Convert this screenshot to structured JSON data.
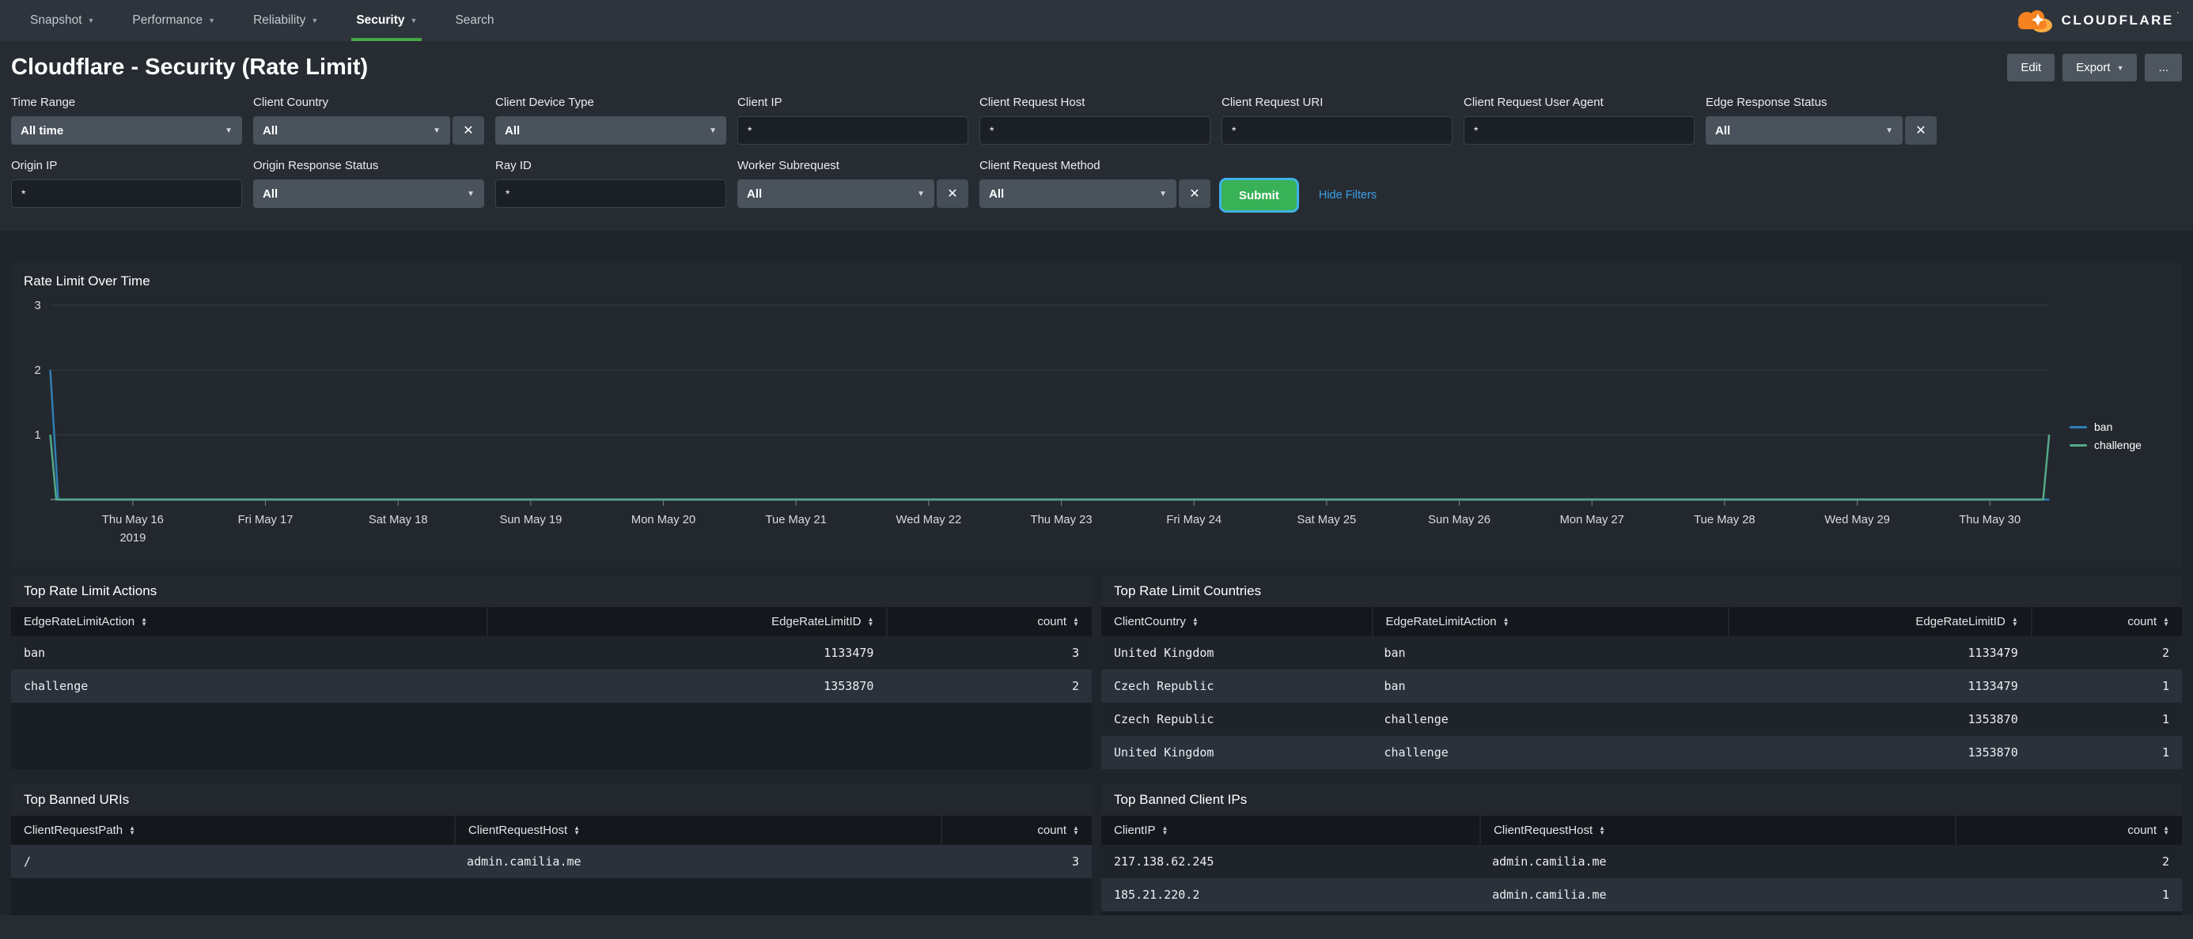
{
  "colors": {
    "accent_green": "#45a745",
    "brand_orange": "#f6821f",
    "brand_orange_light": "#fbad41",
    "submit_green": "#38b157",
    "link_blue": "#3aa0e8",
    "series_ban": "#2f7eb5",
    "series_challenge": "#55a989"
  },
  "icons": {
    "caret": "▼",
    "clear": "✕",
    "sort_asc": "▲",
    "sort_desc": "▼"
  },
  "nav": {
    "items": [
      {
        "label": "Snapshot",
        "caret": true
      },
      {
        "label": "Performance",
        "caret": true
      },
      {
        "label": "Reliability",
        "caret": true
      },
      {
        "label": "Security",
        "caret": true,
        "active": true
      },
      {
        "label": "Search",
        "caret": false
      }
    ]
  },
  "brand": {
    "name": "CLOUDFLARE",
    "mark": "’"
  },
  "header": {
    "title": "Cloudflare - Security (Rate Limit)",
    "edit_label": "Edit",
    "export_label": "Export",
    "more_label": "..."
  },
  "filters": {
    "row1": [
      {
        "label": "Time Range",
        "type": "select",
        "value": "All time",
        "clear": false
      },
      {
        "label": "Client Country",
        "type": "select",
        "value": "All",
        "clear": true
      },
      {
        "label": "Client Device Type",
        "type": "select",
        "value": "All",
        "clear": false
      },
      {
        "label": "Client IP",
        "type": "input",
        "value": "*"
      },
      {
        "label": "Client Request Host",
        "type": "input",
        "value": "*"
      },
      {
        "label": "Client Request URI",
        "type": "input",
        "value": "*"
      },
      {
        "label": "Client Request User Agent",
        "type": "input",
        "value": "*"
      },
      {
        "label": "Edge Response Status",
        "type": "select",
        "value": "All",
        "clear": true
      }
    ],
    "row2": [
      {
        "label": "Origin IP",
        "type": "input",
        "value": "*"
      },
      {
        "label": "Origin Response Status",
        "type": "select",
        "value": "All",
        "clear": false
      },
      {
        "label": "Ray ID",
        "type": "input",
        "value": "*"
      },
      {
        "label": "Worker Subrequest",
        "type": "select",
        "value": "All",
        "clear": true
      },
      {
        "label": "Client Request Method",
        "type": "select",
        "value": "All",
        "clear": true
      }
    ],
    "submit_label": "Submit",
    "hide_filters_label": "Hide Filters"
  },
  "chart_data": {
    "type": "line",
    "title": "Rate Limit Over Time",
    "ylim": [
      0,
      3
    ],
    "y_ticks": [
      1,
      2,
      3
    ],
    "grid": "horizontal",
    "legend_position": "right",
    "x_tick_labels": [
      "Thu May 16",
      "Fri May 17",
      "Sat May 18",
      "Sun May 19",
      "Mon May 20",
      "Tue May 21",
      "Wed May 22",
      "Thu May 23",
      "Fri May 24",
      "Sat May 25",
      "Sun May 26",
      "Mon May 27",
      "Tue May 28",
      "Wed May 29",
      "Thu May 30"
    ],
    "x_first_tick_sublabel": "2019",
    "x_first_tick_frac": 0.0413,
    "x_tick_step_frac": 0.06636,
    "series": [
      {
        "name": "ban",
        "color": "#2f7eb5",
        "points": [
          [
            0,
            2
          ],
          [
            0.004,
            0
          ],
          [
            1,
            0
          ]
        ]
      },
      {
        "name": "challenge",
        "color": "#55a989",
        "points": [
          [
            0,
            1
          ],
          [
            0.003,
            0
          ],
          [
            0.997,
            0
          ],
          [
            1,
            1
          ]
        ]
      }
    ]
  },
  "tables": [
    {
      "title": "Top Rate Limit Actions",
      "stripe_first": "dark",
      "columns": [
        {
          "label": "EdgeRateLimitAction",
          "align": "left"
        },
        {
          "label": "EdgeRateLimitID",
          "align": "right"
        },
        {
          "label": "count",
          "align": "right"
        }
      ],
      "rows": [
        [
          "ban",
          "1133479",
          "3"
        ],
        [
          "challenge",
          "1353870",
          "2"
        ]
      ]
    },
    {
      "title": "Top Rate Limit Countries",
      "stripe_first": "dark",
      "columns": [
        {
          "label": "ClientCountry",
          "align": "left"
        },
        {
          "label": "EdgeRateLimitAction",
          "align": "left"
        },
        {
          "label": "EdgeRateLimitID",
          "align": "right"
        },
        {
          "label": "count",
          "align": "right"
        }
      ],
      "rows": [
        [
          "United Kingdom",
          "ban",
          "1133479",
          "2"
        ],
        [
          "Czech Republic",
          "ban",
          "1133479",
          "1"
        ],
        [
          "Czech Republic",
          "challenge",
          "1353870",
          "1"
        ],
        [
          "United Kingdom",
          "challenge",
          "1353870",
          "1"
        ]
      ]
    },
    {
      "title": "Top Banned URIs",
      "stripe_first": "light",
      "columns": [
        {
          "label": "ClientRequestPath",
          "align": "left"
        },
        {
          "label": "ClientRequestHost",
          "align": "left"
        },
        {
          "label": "count",
          "align": "right"
        }
      ],
      "rows": [
        [
          "/",
          "admin.camilia.me",
          "3"
        ]
      ]
    },
    {
      "title": "Top Banned Client IPs",
      "stripe_first": "dark",
      "columns": [
        {
          "label": "ClientIP",
          "align": "left"
        },
        {
          "label": "ClientRequestHost",
          "align": "left"
        },
        {
          "label": "count",
          "align": "right"
        }
      ],
      "rows": [
        [
          "217.138.62.245",
          "admin.camilia.me",
          "2"
        ],
        [
          "185.21.220.2",
          "admin.camilia.me",
          "1"
        ]
      ]
    }
  ]
}
